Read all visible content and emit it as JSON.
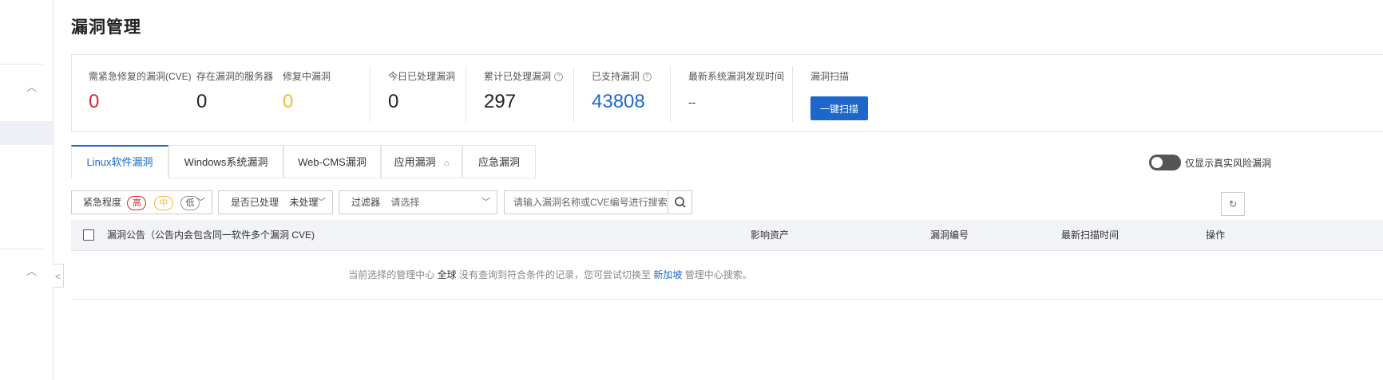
{
  "page": {
    "title": "漏洞管理"
  },
  "stats": {
    "urgent": {
      "label": "需紧急修复的漏洞(CVE)",
      "value": "0",
      "color": "#d4282c"
    },
    "servers": {
      "label": "存在漏洞的服务器",
      "value": "0"
    },
    "fixing": {
      "label": "修复中漏洞",
      "value": "0",
      "color": "#f5b83d"
    },
    "today": {
      "label": "今日已处理漏洞",
      "value": "0"
    },
    "total": {
      "label": "累计已处理漏洞",
      "value": "297"
    },
    "supported": {
      "label": "已支持漏洞",
      "value": "43808",
      "color": "#1d67cb"
    },
    "latest": {
      "label": "最新系统漏洞发现时间",
      "value": "--"
    },
    "scan": {
      "label": "漏洞扫描",
      "button": "一键扫描"
    }
  },
  "tabs": [
    {
      "label": "Linux软件漏洞",
      "active": true
    },
    {
      "label": "Windows系统漏洞"
    },
    {
      "label": "Web-CMS漏洞"
    },
    {
      "label": "应用漏洞"
    },
    {
      "label": "应急漏洞"
    }
  ],
  "toggle": {
    "label": "仅显示真实风险漏洞",
    "on": false
  },
  "filters": {
    "urgency": {
      "label": "紧急程度",
      "levels": [
        "高",
        "中",
        "低"
      ]
    },
    "processed": {
      "label": "是否已处理",
      "value": "未处理"
    },
    "filter": {
      "label": "过滤器",
      "placeholder": "请选择"
    },
    "search": {
      "placeholder": "请输入漏洞名称或CVE编号进行搜索"
    }
  },
  "table": {
    "columns": [
      "漏洞公告（公告内会包含同一软件多个漏洞 CVE)",
      "影响资产",
      "漏洞编号",
      "最新扫描时间",
      "操作"
    ],
    "empty": {
      "prefix": "当前选择的管理中心",
      "scope": "全球",
      "middle": "没有查询到符合条件的记录，您可尝试切换至",
      "region": "新加坡",
      "suffix": "管理中心搜索。"
    }
  },
  "colors": {
    "accent": "#1d67cb",
    "danger": "#d4282c",
    "warning": "#f5b83d"
  }
}
